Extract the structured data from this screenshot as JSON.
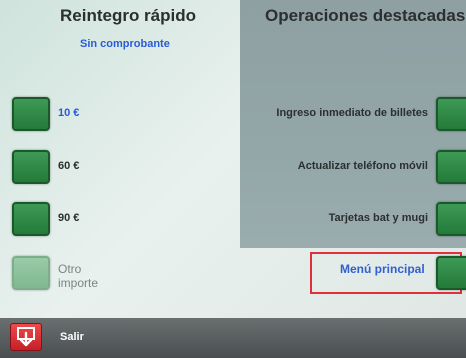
{
  "left": {
    "title": "Reintegro rápido",
    "subtitle": "Sin comprobante",
    "options": [
      {
        "label": "10 €"
      },
      {
        "label": "60 €"
      },
      {
        "label": "90 €"
      },
      {
        "label_line1": "Otro",
        "label_line2": "importe"
      }
    ]
  },
  "right": {
    "title": "Operaciones destacadas",
    "options": [
      {
        "label": "Ingreso inmediato de billetes"
      },
      {
        "label": "Actualizar teléfono móvil"
      },
      {
        "label": "Tarjetas bat y mugi"
      }
    ],
    "menu_label": "Menú principal"
  },
  "footer": {
    "exit_label": "Salir"
  },
  "colors": {
    "button_green": "#2e8a47",
    "link_blue": "#2a5bd7",
    "exit_red": "#d62a32",
    "highlight_red": "#e0303a"
  }
}
